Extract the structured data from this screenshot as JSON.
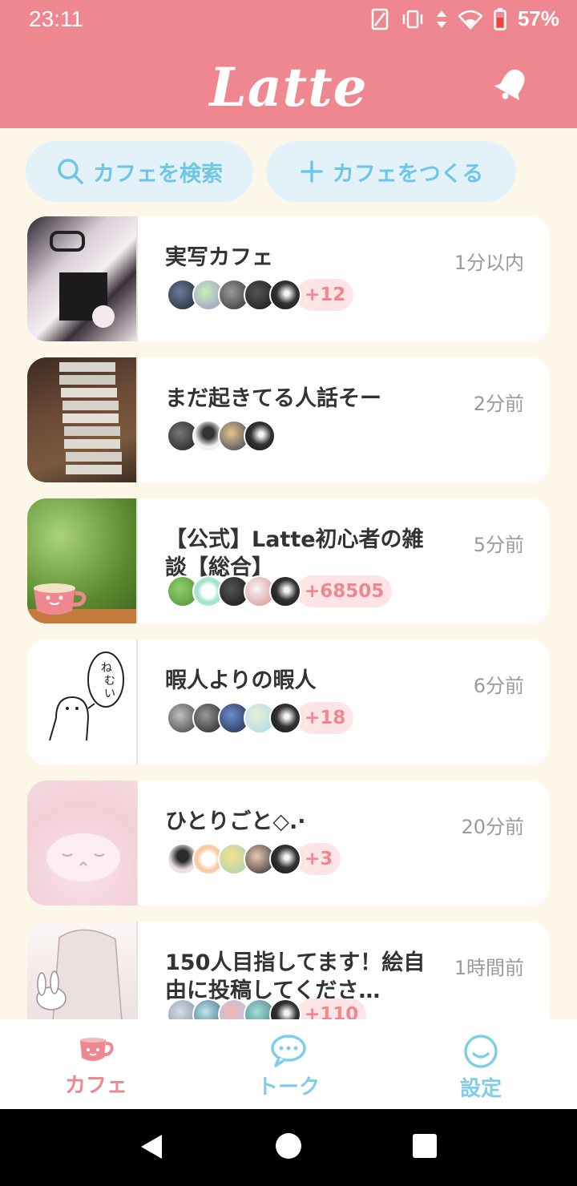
{
  "status_bar": {
    "time": "23:11",
    "battery": "57%"
  },
  "header": {
    "title": "Latte",
    "notification_icon": "bell-icon"
  },
  "actions": {
    "search_label": "カフェを検索",
    "create_label": "カフェをつくる"
  },
  "cafes": [
    {
      "name": "実写カフェ",
      "time": "1分以内",
      "more": "+12"
    },
    {
      "name": "まだ起きてる人話そー",
      "time": "2分前",
      "more": ""
    },
    {
      "name": "【公式】Latte初心者の雑談【総合】",
      "time": "5分前",
      "more": "+68505"
    },
    {
      "name": "暇人よりの暇人",
      "time": "6分前",
      "more": "+18"
    },
    {
      "name": "ひとりごと◇.·",
      "time": "20分前",
      "more": "+3"
    },
    {
      "name": "150人目指してます！絵自由に投稿してくださ…",
      "time": "1時間前",
      "more": "+110"
    }
  ],
  "nav": {
    "cafe_label": "カフェ",
    "talk_label": "トーク",
    "settings_label": "設定"
  },
  "colors": {
    "brand_pink": "#ef8790",
    "accent_blue": "#7fcde9",
    "background": "#fdf7e9"
  }
}
